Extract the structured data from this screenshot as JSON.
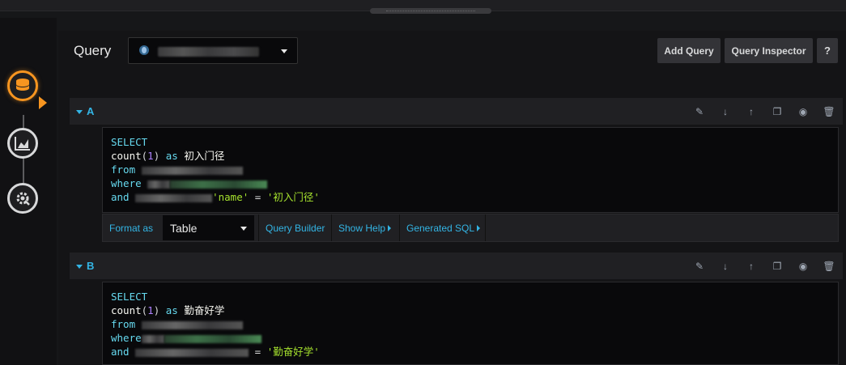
{
  "header": {
    "title": "Query",
    "add_query": "Add Query",
    "query_inspector": "Query Inspector",
    "help": "?"
  },
  "queries": [
    {
      "letter": "A",
      "sql": {
        "l1": "SELECT",
        "l2_fn": "count",
        "l2_num": "1",
        "l2_as": "as",
        "l2_alias": "初入门径",
        "l3_kw": "from",
        "l4_kw": "where",
        "l5_kw": "and",
        "l5_col": "'name'",
        "l5_eq": "=",
        "l5_val": "'初入门径'"
      },
      "toolbar": {
        "format_as": "Format as",
        "format_value": "Table",
        "query_builder": "Query Builder",
        "show_help": "Show Help",
        "generated_sql": "Generated SQL"
      }
    },
    {
      "letter": "B",
      "sql": {
        "l1": "SELECT",
        "l2_fn": "count",
        "l2_num": "1",
        "l2_as": "as",
        "l2_alias": "勤奋好学",
        "l3_kw": "from",
        "l4_kw": "where",
        "l5_kw": "and",
        "l5_eq": "=",
        "l5_val": "'勤奋好学'"
      }
    }
  ],
  "icons": {
    "rail": [
      "database-icon",
      "chart-area-icon",
      "settings-icon"
    ],
    "row_tools": [
      "pencil-icon",
      "arrow-down-icon",
      "arrow-up-icon",
      "duplicate-icon",
      "eye-icon",
      "trash-icon"
    ]
  },
  "colors": {
    "accent_blue": "#33b5e5",
    "accent_orange": "#f79520",
    "keyword": "#66d9ef",
    "string": "#a6e22e",
    "number": "#ae81ff"
  }
}
